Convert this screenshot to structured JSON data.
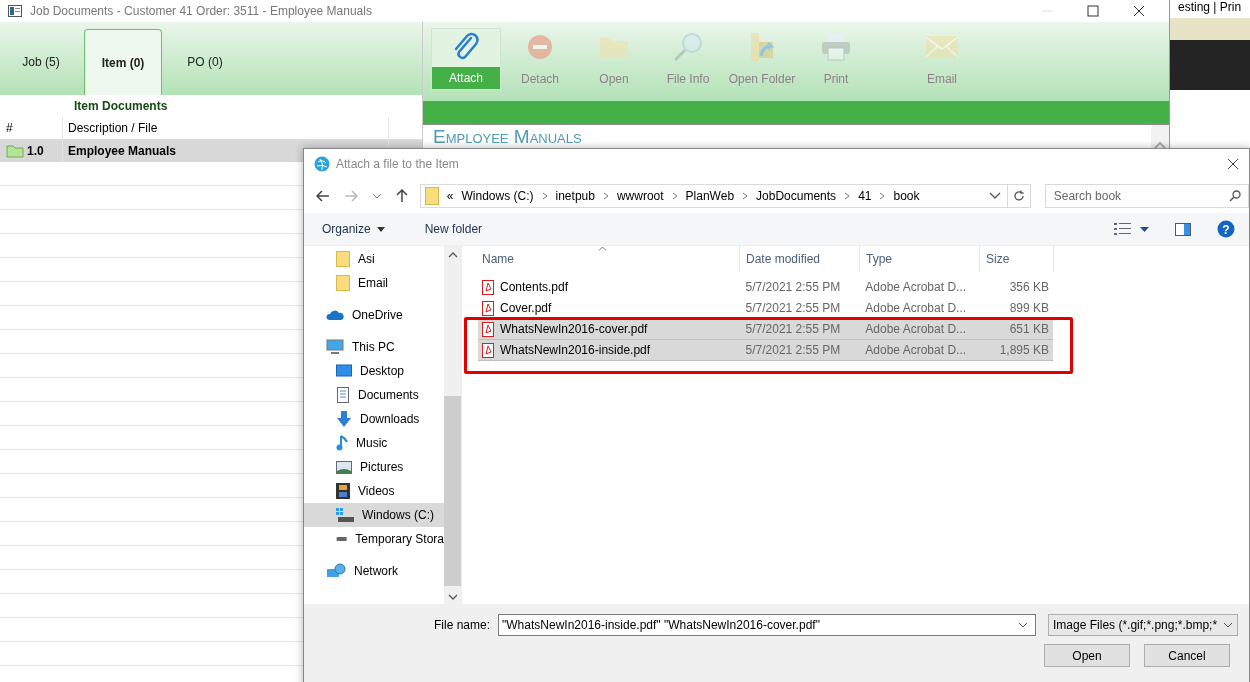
{
  "window": {
    "title": "Job Documents - Customer 41 Order: 3511 - Employee Manuals"
  },
  "tabs": [
    {
      "label": "Job (5)",
      "selected": false
    },
    {
      "label": "Item (0)",
      "selected": true
    },
    {
      "label": "PO (0)",
      "selected": false
    }
  ],
  "ribbon": [
    {
      "label": "Attach",
      "kind": "clip",
      "disabled": false,
      "selected": true
    },
    {
      "label": "Detach",
      "kind": "minus",
      "disabled": true,
      "selected": false
    },
    {
      "label": "Open",
      "kind": "folder",
      "disabled": true,
      "selected": false
    },
    {
      "label": "File Info",
      "kind": "magnifier",
      "disabled": true,
      "selected": false
    },
    {
      "label": "Open Folder",
      "kind": "folder-link",
      "disabled": true,
      "selected": false
    },
    {
      "label": "Print",
      "kind": "printer",
      "disabled": true,
      "selected": false
    },
    {
      "label": "Email",
      "kind": "envelope",
      "disabled": true,
      "selected": false
    }
  ],
  "documents": {
    "title": "Item Documents",
    "columns": [
      "#",
      "Description / File"
    ],
    "rows": [
      {
        "number": "1.0",
        "description": "Employee Manuals",
        "selected": true
      }
    ]
  },
  "preview": {
    "heading": "Employee Manuals"
  },
  "background_app": {
    "text": "esting | Prin"
  },
  "dialog": {
    "title": "Attach a file to the Item",
    "overflow": "«",
    "path": [
      "Windows (C:)",
      "inetpub",
      "wwwroot",
      "PlanWeb",
      "JobDocuments",
      "41",
      "book"
    ],
    "search": {
      "placeholder": "Search book"
    },
    "commands": [
      "Organize",
      "New folder"
    ],
    "help": "?",
    "nav": [
      {
        "label": "Asi",
        "kind": "folder",
        "selected": false
      },
      {
        "label": "Email",
        "kind": "folder",
        "selected": false
      },
      {
        "label": "OneDrive",
        "kind": "cloud",
        "selected": false
      },
      {
        "label": "This PC",
        "kind": "pc",
        "selected": false,
        "children": [
          {
            "label": "Desktop",
            "kind": "desktop",
            "selected": false
          },
          {
            "label": "Documents",
            "kind": "documents",
            "selected": false
          },
          {
            "label": "Downloads",
            "kind": "downloads",
            "selected": false
          },
          {
            "label": "Music",
            "kind": "music",
            "selected": false
          },
          {
            "label": "Pictures",
            "kind": "pictures",
            "selected": false
          },
          {
            "label": "Videos",
            "kind": "videos",
            "selected": false
          },
          {
            "label": "Windows (C:)",
            "kind": "drive",
            "selected": true
          },
          {
            "label": "Temporary Stora",
            "kind": "removable",
            "selected": false
          }
        ]
      },
      {
        "label": "Network",
        "kind": "network",
        "selected": false
      }
    ],
    "columns": [
      "Name",
      "Date modified",
      "Type",
      "Size"
    ],
    "files": [
      {
        "name": "Contents.pdf",
        "date": "5/7/2021 2:55 PM",
        "type": "Adobe Acrobat D...",
        "size": "356 KB",
        "selected": false
      },
      {
        "name": "Cover.pdf",
        "date": "5/7/2021 2:55 PM",
        "type": "Adobe Acrobat D...",
        "size": "899 KB",
        "selected": false
      },
      {
        "name": "WhatsNewIn2016-cover.pdf",
        "date": "5/7/2021 2:55 PM",
        "type": "Adobe Acrobat D...",
        "size": "651 KB",
        "selected": true
      },
      {
        "name": "WhatsNewIn2016-inside.pdf",
        "date": "5/7/2021 2:55 PM",
        "type": "Adobe Acrobat D...",
        "size": "1,895 KB",
        "selected": true
      }
    ],
    "file_name_label": "File name:",
    "file_name": "\"WhatsNewIn2016-inside.pdf\" \"WhatsNewIn2016-cover.pdf\"",
    "filter": "Image Files (*.gif;*.png;*.bmp;*",
    "buttons": [
      "Open",
      "Cancel"
    ]
  }
}
